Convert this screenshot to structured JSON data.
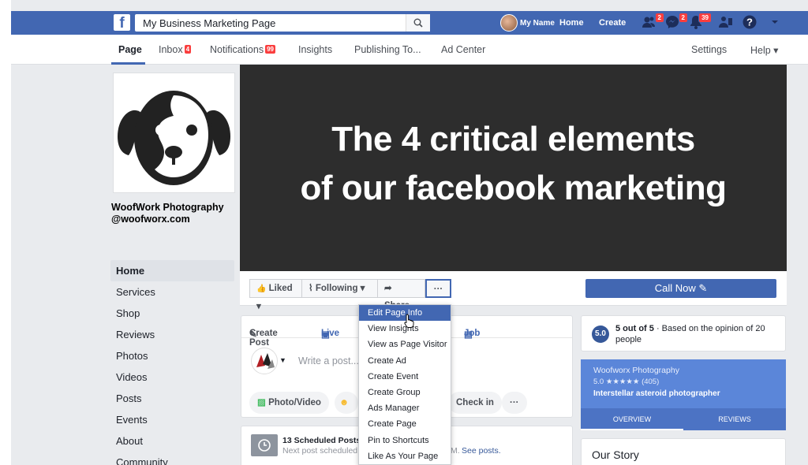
{
  "topbar": {
    "logo": "f",
    "search_value": "My Business Marketing Page",
    "user_name": "My Name",
    "home": "Home",
    "create": "Create",
    "friend_badge": "2",
    "messages_badge": "2",
    "notif_badge": "39",
    "brand_color": "#4267b2"
  },
  "subnav": {
    "page": "Page",
    "inbox": "Inbox",
    "inbox_badge": "4",
    "notifications": "Notifications",
    "notifications_badge": "99",
    "insights": "Insights",
    "publishing": "Publishing To...",
    "ad_center": "Ad Center",
    "settings": "Settings",
    "help": "Help ▾"
  },
  "profile": {
    "name": "WoofWork Photography",
    "handle": "@woofworx.com"
  },
  "sidebar": {
    "items": [
      "Home",
      "Services",
      "Shop",
      "Reviews",
      "Photos",
      "Videos",
      "Posts",
      "Events",
      "About",
      "Community"
    ]
  },
  "cover": {
    "line1": "The 4 critical elements",
    "line2": "of our facebook marketing"
  },
  "actions": {
    "liked": "Liked ▾",
    "following": "Following ▾",
    "share": "Share",
    "more": "···",
    "call_now": "Call Now"
  },
  "composer": {
    "create_post": "Create Post",
    "live": "Live",
    "job": "Job",
    "placeholder": "Write a post...",
    "photo_video": "Photo/Video",
    "check_in": "Check in",
    "more": "···"
  },
  "scheduled": {
    "title": "13 Scheduled Posts",
    "subtitle": "Next post scheduled",
    "suffix": "M.",
    "see_posts": "See posts."
  },
  "menu": {
    "items": [
      "Edit Page Info",
      "View Insights",
      "View as Page Visitor",
      "Create Ad",
      "Create Event",
      "Create Group",
      "Ads Manager",
      "Create Page",
      "Pin to Shortcuts",
      "Like As Your Page"
    ]
  },
  "rating": {
    "score": "5.0",
    "text": "5 out of 5",
    "detail": "· Based on the opinion of 20 people"
  },
  "business_card": {
    "name": "Woofworx Photography",
    "stars": "5.0 ★★★★★ (405)",
    "tagline": "Interstellar asteroid photographer",
    "tab_overview": "OVERVIEW",
    "tab_reviews": "REVIEWS"
  },
  "story": {
    "title": "Our Story"
  }
}
